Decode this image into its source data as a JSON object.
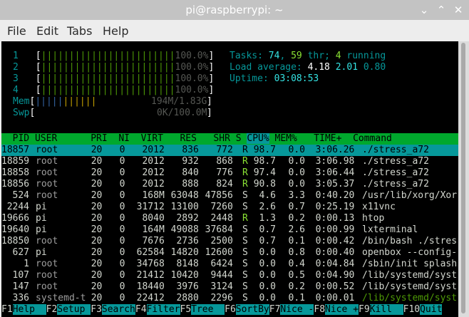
{
  "window": {
    "title": "pi@raspberrypi: ~",
    "buttons": [
      "⌄",
      "⌃",
      "✕"
    ]
  },
  "menu": [
    "File",
    "Edit",
    "Tabs",
    "Help"
  ],
  "cpus": [
    {
      "id": "1",
      "bar": "||||||||||||||||||||||||",
      "pct": "100.0%"
    },
    {
      "id": "2",
      "bar": "||||||||||||||||||||||||",
      "pct": "100.0%"
    },
    {
      "id": "3",
      "bar": "||||||||||||||||||||||||",
      "pct": "100.0%"
    },
    {
      "id": "4",
      "bar": "||||||||||||||||||||||||",
      "pct": "100.0%"
    }
  ],
  "mem": {
    "label": "Mem",
    "bar1": "|||||",
    "bar2": "||||||",
    "value": "194M/1.83G"
  },
  "swp": {
    "label": "Swp",
    "value": "0K/100.0M"
  },
  "tasks": {
    "label": "Tasks: ",
    "count": "74",
    "sep": ", ",
    "thr": "59",
    "thr_label": " thr; ",
    "running": "4",
    "running_label": " running"
  },
  "load": {
    "label": "Load average: ",
    "l1": "4.18",
    "l5": "2.01",
    "l15": "0.80"
  },
  "uptime": {
    "label": "Uptime: ",
    "value": "03:08:53"
  },
  "header": {
    "pre": "  PID USER      PRI  NI  VIRT   RES   SHR S ",
    "cpu": "CPU%",
    "post": " MEM%   TIME+  Command"
  },
  "processes": [
    {
      "pid": "18857",
      "user": "root",
      "pri": "20",
      "ni": "0",
      "virt": "2012",
      "res": "836",
      "shr": "772",
      "s": "R",
      "cpu": "98.7",
      "mem": "0.0",
      "time": "3:06.26",
      "cmd": "./stress_a72"
    },
    {
      "pid": "18859",
      "user": "root",
      "pri": "20",
      "ni": "0",
      "virt": "2012",
      "res": "932",
      "shr": "868",
      "s": "R",
      "cpu": "98.7",
      "mem": "0.0",
      "time": "3:06.98",
      "cmd": "./stress_a72"
    },
    {
      "pid": "18858",
      "user": "root",
      "pri": "20",
      "ni": "0",
      "virt": "2012",
      "res": "840",
      "shr": "776",
      "s": "R",
      "cpu": "97.4",
      "mem": "0.0",
      "time": "3:06.44",
      "cmd": "./stress_a72"
    },
    {
      "pid": "18856",
      "user": "root",
      "pri": "20",
      "ni": "0",
      "virt": "2012",
      "res": "888",
      "shr": "824",
      "s": "R",
      "cpu": "90.8",
      "mem": "0.0",
      "time": "3:05.37",
      "cmd": "./stress_a72"
    },
    {
      "pid": "524",
      "user": "root",
      "pri": "20",
      "ni": "0",
      "virt": "168M",
      "res": "63048",
      "shr": "47856",
      "s": "S",
      "cpu": "4.6",
      "mem": "3.3",
      "time": "0:40.20",
      "cmd": "/usr/lib/xorg/Xor"
    },
    {
      "pid": "2244",
      "user": "pi",
      "pri": "20",
      "ni": "0",
      "virt": "31712",
      "res": "13100",
      "shr": "7260",
      "s": "S",
      "cpu": "2.6",
      "mem": "0.7",
      "time": "0:25.19",
      "cmd": "x11vnc"
    },
    {
      "pid": "19666",
      "user": "pi",
      "pri": "20",
      "ni": "0",
      "virt": "8040",
      "res": "2892",
      "shr": "2448",
      "s": "R",
      "cpu": "1.3",
      "mem": "0.2",
      "time": "0:00.13",
      "cmd": "htop"
    },
    {
      "pid": "19640",
      "user": "pi",
      "pri": "20",
      "ni": "0",
      "virt": "164M",
      "res": "49088",
      "shr": "37684",
      "s": "S",
      "cpu": "0.7",
      "mem": "2.6",
      "time": "0:00.99",
      "cmd": "lxterminal"
    },
    {
      "pid": "18850",
      "user": "root",
      "pri": "20",
      "ni": "0",
      "virt": "7676",
      "res": "2736",
      "shr": "2500",
      "s": "S",
      "cpu": "0.7",
      "mem": "0.1",
      "time": "0:00.42",
      "cmd": "/bin/bash ./stres"
    },
    {
      "pid": "627",
      "user": "pi",
      "pri": "20",
      "ni": "0",
      "virt": "62584",
      "res": "14820",
      "shr": "12600",
      "s": "S",
      "cpu": "0.0",
      "mem": "0.8",
      "time": "0:00.40",
      "cmd": "openbox --config-"
    },
    {
      "pid": "1",
      "user": "root",
      "pri": "20",
      "ni": "0",
      "virt": "34768",
      "res": "8148",
      "shr": "6424",
      "s": "S",
      "cpu": "0.0",
      "mem": "0.4",
      "time": "0:04.84",
      "cmd": "/sbin/init splash"
    },
    {
      "pid": "107",
      "user": "root",
      "pri": "20",
      "ni": "0",
      "virt": "21412",
      "res": "10420",
      "shr": "9444",
      "s": "S",
      "cpu": "0.0",
      "mem": "0.5",
      "time": "0:04.90",
      "cmd": "/lib/systemd/syst"
    },
    {
      "pid": "147",
      "user": "root",
      "pri": "20",
      "ni": "0",
      "virt": "18440",
      "res": "3976",
      "shr": "3124",
      "s": "S",
      "cpu": "0.0",
      "mem": "0.2",
      "time": "0:00.52",
      "cmd": "/lib/systemd/syst"
    },
    {
      "pid": "336",
      "user": "systemd-t",
      "pri": "20",
      "ni": "0",
      "virt": "22412",
      "res": "2880",
      "shr": "2296",
      "s": "S",
      "cpu": "0.0",
      "mem": "0.1",
      "time": "0:00.01",
      "cmd": "/lib/systemd/syst"
    }
  ],
  "fkeys": [
    {
      "key": "F1",
      "label": "Help  "
    },
    {
      "key": "F2",
      "label": "Setup "
    },
    {
      "key": "F3",
      "label": "Search"
    },
    {
      "key": "F4",
      "label": "Filter"
    },
    {
      "key": "F5",
      "label": "Tree  "
    },
    {
      "key": "F6",
      "label": "SortBy"
    },
    {
      "key": "F7",
      "label": "Nice -"
    },
    {
      "key": "F8",
      "label": "Nice +"
    },
    {
      "key": "F9",
      "label": "Kill  "
    },
    {
      "key": "F10",
      "label": "Quit"
    }
  ],
  "colors": {
    "header_bg": "#00a82d",
    "selection_bg": "#06989a",
    "terminal_bg": "#000000",
    "titlebar_bg": "#c3c3c3"
  }
}
